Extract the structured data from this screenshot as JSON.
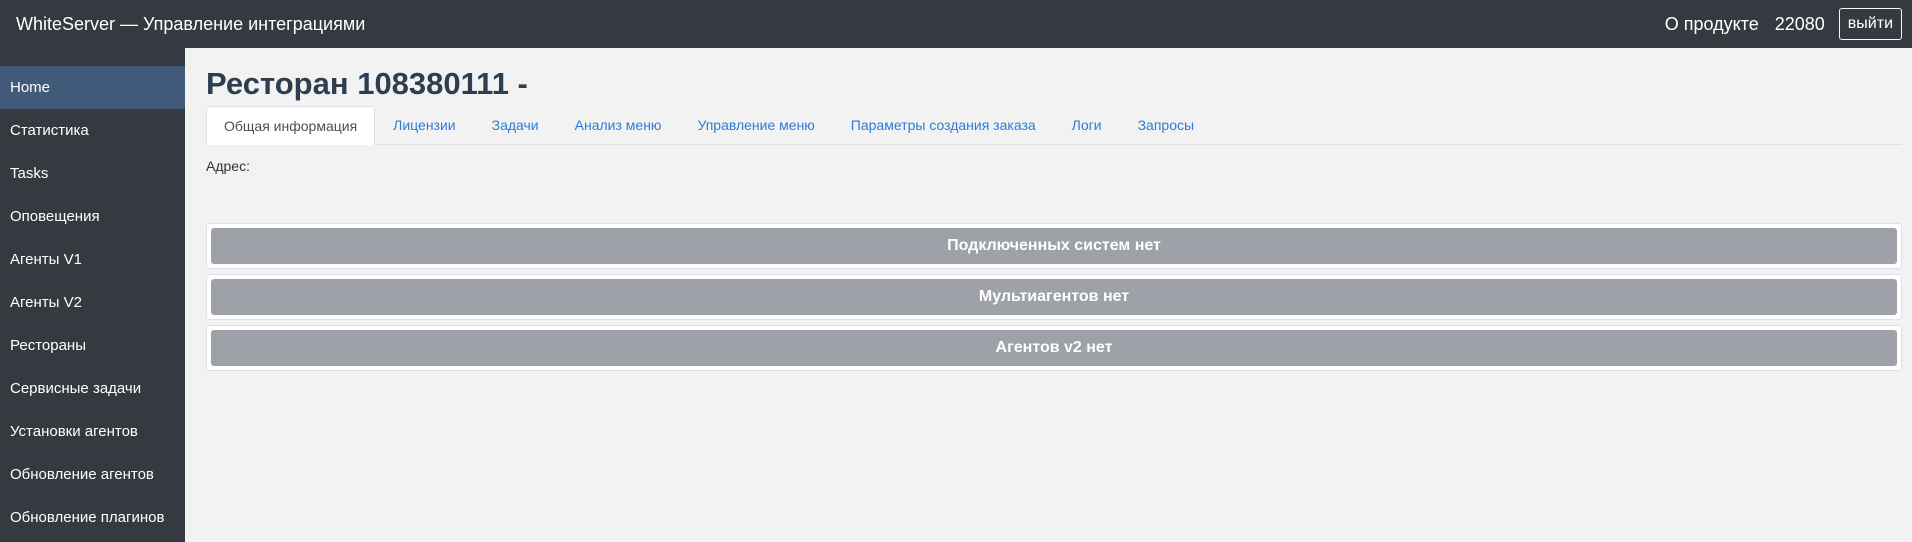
{
  "header": {
    "title": "WhiteServer — Управление интеграциями",
    "about_label": "О продукте",
    "user_id": "22080",
    "logout_label": "выйти"
  },
  "sidebar": {
    "items": [
      {
        "label": "Home",
        "active": true
      },
      {
        "label": "Статистика"
      },
      {
        "label": "Tasks"
      },
      {
        "label": "Оповещения"
      },
      {
        "label": "Агенты V1"
      },
      {
        "label": "Агенты V2"
      },
      {
        "label": "Рестораны"
      },
      {
        "label": "Сервисные задачи"
      },
      {
        "label": "Установки агентов"
      },
      {
        "label": "Обновление агентов"
      },
      {
        "label": "Обновление плагинов"
      }
    ]
  },
  "main": {
    "title": "Ресторан 108380111 -",
    "tabs": [
      {
        "label": "Общая информация",
        "active": true
      },
      {
        "label": "Лицензии"
      },
      {
        "label": "Задачи"
      },
      {
        "label": "Анализ меню"
      },
      {
        "label": "Управление меню"
      },
      {
        "label": "Параметры создания заказа"
      },
      {
        "label": "Логи"
      },
      {
        "label": "Запросы"
      }
    ],
    "address_label": "Адрес:",
    "panels": [
      {
        "label": "Подключенных систем нет"
      },
      {
        "label": "Мультиагентов нет"
      },
      {
        "label": "Агентов v2 нет"
      }
    ]
  }
}
